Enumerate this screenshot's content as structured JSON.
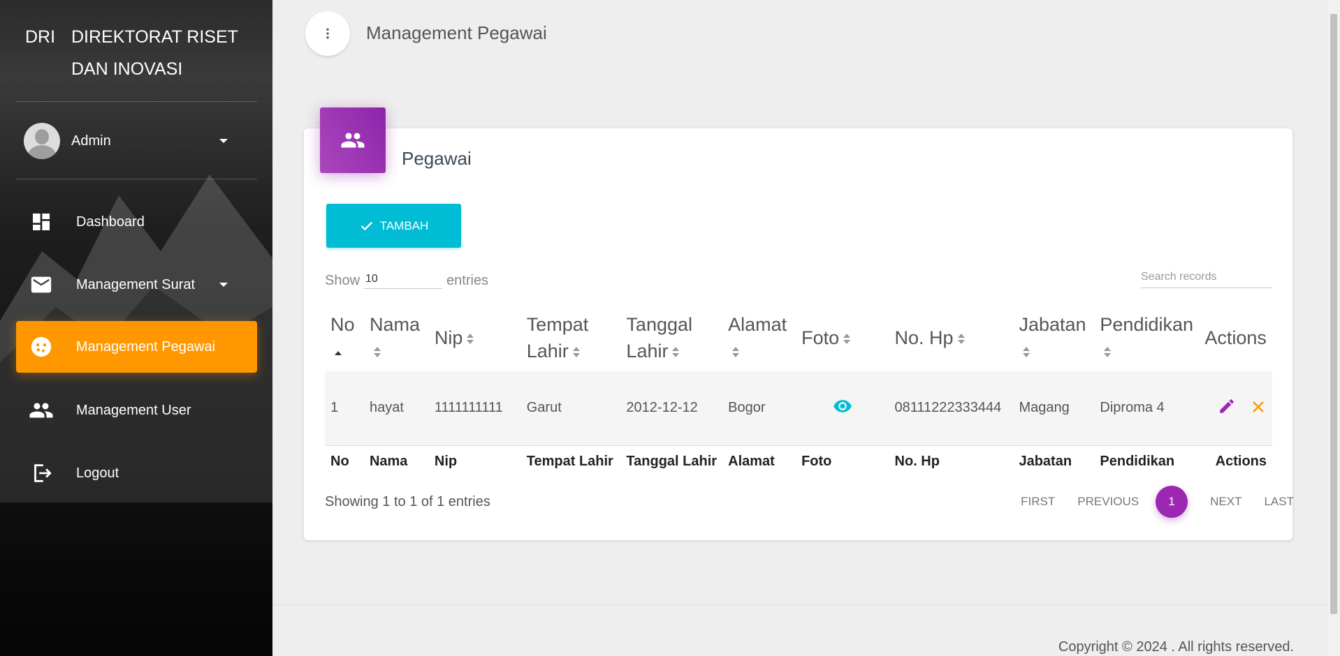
{
  "brand": {
    "mini": "DRI",
    "full": "DIREKTORAT RISET DAN INOVASI"
  },
  "user": {
    "name": "Admin"
  },
  "sidebar": {
    "items": [
      {
        "label": "Dashboard",
        "icon": "dashboard-icon"
      },
      {
        "label": "Management Surat",
        "icon": "mail-icon"
      },
      {
        "label": "Management Pegawai",
        "icon": "face-icon",
        "active": true
      },
      {
        "label": "Management User",
        "icon": "people-icon"
      },
      {
        "label": "Logout",
        "icon": "logout-icon"
      }
    ]
  },
  "header": {
    "title": "Management Pegawai"
  },
  "card": {
    "title": "Pegawai",
    "add_label": "TAMBAH"
  },
  "table_controls": {
    "show": "Show",
    "length": "10",
    "entries": "entries",
    "search_placeholder": "Search records"
  },
  "table": {
    "headers": [
      "No",
      "Nama",
      "Nip",
      "Tempat Lahir",
      "Tanggal Lahir",
      "Alamat",
      "Foto",
      "No. Hp",
      "Jabatan",
      "Pendidikan",
      "Actions"
    ],
    "rows": [
      {
        "no": "1",
        "nama": "hayat",
        "nip": "1111111111",
        "tempat_lahir": "Garut",
        "tanggal_lahir": "2012-12-12",
        "alamat": "Bogor",
        "no_hp": "08111222333444",
        "jabatan": "Magang",
        "pendidikan": "Diproma 4"
      }
    ]
  },
  "pagination": {
    "info": "Showing 1 to 1 of 1 entries",
    "first": "FIRST",
    "previous": "PREVIOUS",
    "current": "1",
    "next": "NEXT",
    "last": "LAST"
  },
  "footer": {
    "copyright": "Copyright © 2024 . All rights reserved."
  },
  "colors": {
    "accent_orange": "#ff9800",
    "accent_purple": "#9c27b0",
    "accent_cyan": "#00bcd4"
  }
}
